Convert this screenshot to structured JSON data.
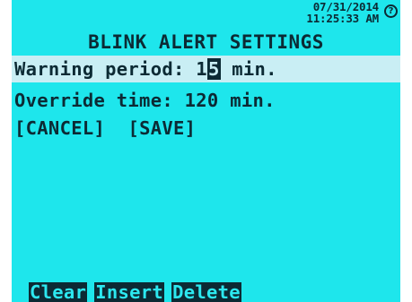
{
  "header": {
    "date": "07/31/2014",
    "time": "11:25:33 AM",
    "help_symbol": "?",
    "help_icon": "help-icon",
    "title": "BLINK ALERT SETTINGS"
  },
  "settings": {
    "warning_label": "Warning period: ",
    "warning_value_digit1": "1",
    "warning_value_digit2": "5",
    "warning_unit": " min.",
    "override_label": "Override time: ",
    "override_value": "120",
    "override_unit": " min."
  },
  "actions": {
    "cancel_label": "[CANCEL]",
    "save_label": "[SAVE]"
  },
  "softkeys": {
    "clear_label": "Clear",
    "insert_label": "Insert",
    "delete_label": "Delete"
  },
  "colors": {
    "background": "#1ee6ec",
    "selection": "#c9eef4",
    "text": "#0c2a34"
  }
}
